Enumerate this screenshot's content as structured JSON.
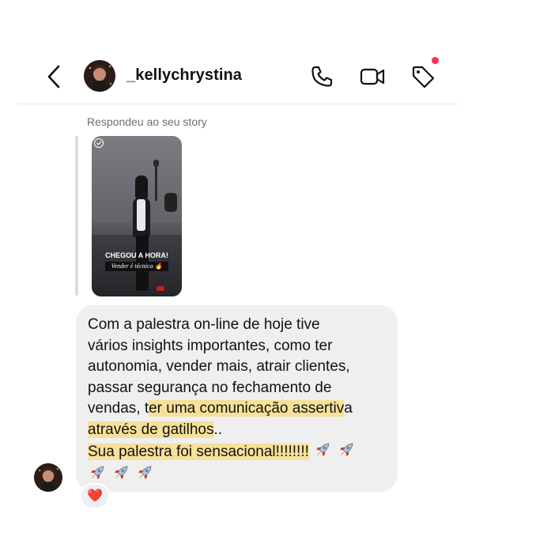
{
  "header": {
    "username": "_kellychrystina",
    "icons": [
      "back-chevron-icon",
      "phone-icon",
      "video-call-icon",
      "tag-icon"
    ],
    "notification_dot_color": "#ff2d55"
  },
  "story_reply": {
    "label": "Respondeu ao seu story",
    "story_caption_title": "CHEGOU A HORA!",
    "story_caption_subtitle": "Vender é técnica 🔥"
  },
  "message": {
    "line1": "Com a palestra on-line de hoje tive",
    "line2": "vários insights importantes, como ter",
    "line3": "autonomia, vender mais, atrair clientes,",
    "line4": "passar segurança no fechamento de",
    "line5_a": "vendas, t",
    "line5_b": "er uma comunicação assertiv",
    "line5_c": "a",
    "line6_a": "através de gatilhos",
    "line6_b": "..",
    "line7": "Sua palestra foi sensacional!!!!!!!!",
    "emoji": "rocket-emoji",
    "highlight_color": "#f6e19a",
    "bubble_color": "#efefef"
  },
  "reaction": {
    "emoji": "❤️",
    "icon": "heart-icon"
  }
}
